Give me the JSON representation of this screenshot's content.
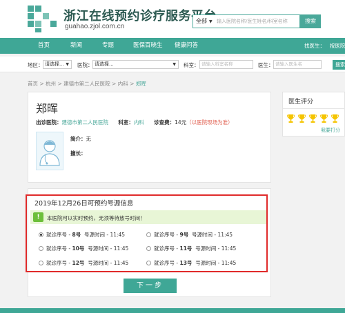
{
  "site": {
    "title": "浙江在线预约诊疗服务平台",
    "url": "guahao.zjol.com.cn"
  },
  "search": {
    "scope": "全部",
    "placeholder": "输入医院名称/医生姓名/科室名称",
    "button": "搜索"
  },
  "nav": {
    "items": [
      "首页",
      "新闻",
      "专题",
      "医保百晓生",
      "健康问答"
    ],
    "right_label": "找医生：",
    "right_link": "按医院"
  },
  "filter": {
    "region_label": "地区：",
    "region_value": "请选择...",
    "hospital_label": "医院：",
    "hospital_value": "请选择...",
    "dept_label": "科室：",
    "dept_placeholder": "请输入科室名称",
    "doctor_label": "医生：",
    "doctor_placeholder": "请输入医生名",
    "button": "搜索"
  },
  "breadcrumb": [
    "首页",
    "杭州",
    "建德市第二人民医院",
    "内科",
    "郑晖"
  ],
  "doctor": {
    "name": "郑晖",
    "hospital_label": "出诊医院：",
    "hospital": "建德市第二人民医院",
    "dept_label": "科室：",
    "dept": "内科",
    "fee_label": "诊查费：",
    "fee": "14元",
    "fee_note": "（以医院现场为准）",
    "intro_label": "简介：",
    "intro": "无",
    "specialty_label": "擅长：",
    "specialty": ""
  },
  "score": {
    "title": "医生评分",
    "trophies": 5,
    "link": "我要打分"
  },
  "schedule": {
    "title": "2019年12月26日可预约号源信息",
    "notice": "本医院可以实时预约，无须等待放号时间！",
    "prefix": "就诊序号 - ",
    "time_label": "号源时间 - ",
    "slots": [
      {
        "number": "8号",
        "time": "11:45",
        "selected": true
      },
      {
        "number": "9号",
        "time": "11:45",
        "selected": false
      },
      {
        "number": "10号",
        "time": "11:45",
        "selected": false
      },
      {
        "number": "11号",
        "time": "11:45",
        "selected": false
      },
      {
        "number": "12号",
        "time": "11:45",
        "selected": false
      },
      {
        "number": "13号",
        "time": "11:45",
        "selected": false
      }
    ],
    "next_button": "下一步"
  },
  "colors": {
    "brand": "#3fa796",
    "highlight_border": "#e02a2a",
    "notice_bg": "#e8f6d6",
    "trophy": "#f5c400"
  }
}
